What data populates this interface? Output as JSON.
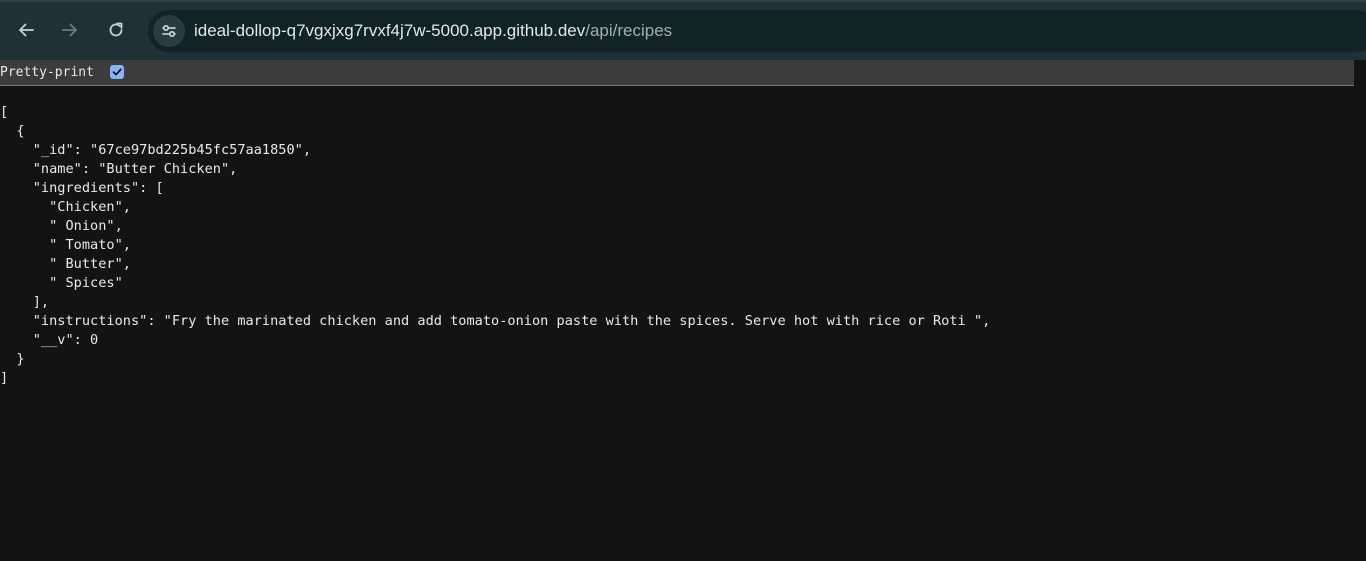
{
  "browser": {
    "back_icon": "arrow-left-icon",
    "forward_icon": "arrow-right-icon",
    "reload_icon": "reload-icon",
    "site_info_icon": "tune-icon",
    "url_host": "ideal-dollop-q7vgxjxg7rvxf4j7w-5000.app.github.dev",
    "url_path": "/api/recipes"
  },
  "viewer": {
    "pretty_print_label": "Pretty-print",
    "pretty_print_checked": true
  },
  "json_lines": [
    "[",
    "  {",
    "    \"_id\": \"67ce97bd225b45fc57aa1850\",",
    "    \"name\": \"Butter Chicken\",",
    "    \"ingredients\": [",
    "      \"Chicken\",",
    "      \" Onion\",",
    "      \" Tomato\",",
    "      \" Butter\",",
    "      \" Spices\"",
    "    ],",
    "    \"instructions\": \"Fry the marinated chicken and add tomato-onion paste with the spices. Serve hot with rice or Roti \",",
    "    \"__v\": 0",
    "  }",
    "]"
  ],
  "colors": {
    "toolbar": "#1f3137",
    "omnibox": "#102327",
    "page_bg": "#131313",
    "checkbox": "#8ab4f8"
  }
}
